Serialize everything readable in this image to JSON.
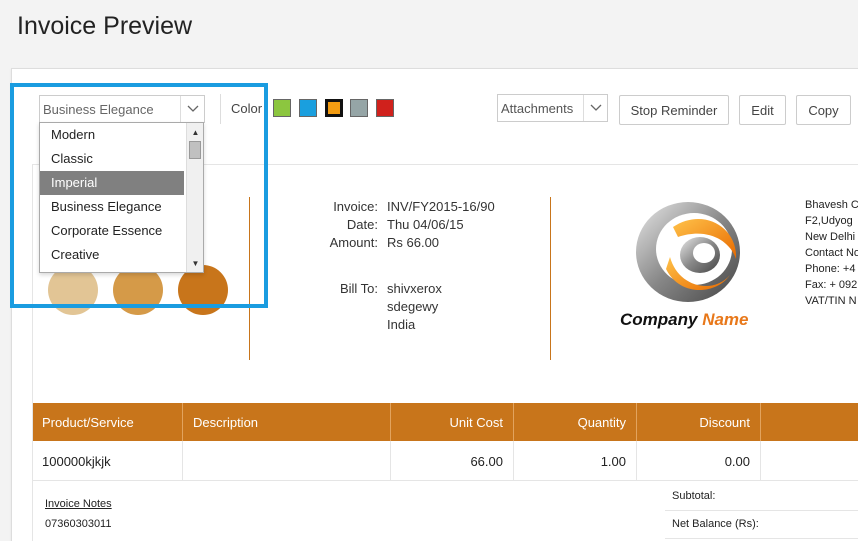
{
  "page": {
    "title": "Invoice Preview"
  },
  "toolbar": {
    "template_select": {
      "value": "Business Elegance"
    },
    "color_label": "Color",
    "colors": [
      {
        "name": "green",
        "hex": "#8cc63f",
        "selected": false
      },
      {
        "name": "blue",
        "hex": "#1a9fde",
        "selected": false
      },
      {
        "name": "orange",
        "hex": "#f39c12",
        "selected": true
      },
      {
        "name": "gray",
        "hex": "#95a5a6",
        "selected": false
      },
      {
        "name": "red",
        "hex": "#d0211c",
        "selected": false
      }
    ],
    "attachments_select": {
      "value": "Attachments"
    },
    "stop_reminder_label": "Stop Reminder",
    "edit_label": "Edit",
    "copy_label": "Copy"
  },
  "template_dropdown": {
    "items": [
      {
        "label": "Modern",
        "active": false
      },
      {
        "label": "Classic",
        "active": false
      },
      {
        "label": "Imperial",
        "active": true
      },
      {
        "label": "Business Elegance",
        "active": false
      },
      {
        "label": "Corporate Essence",
        "active": false
      },
      {
        "label": "Creative",
        "active": false
      }
    ]
  },
  "invoice": {
    "shade_circles": [
      "#e2c595",
      "#d59a48",
      "#c8751b"
    ],
    "meta": {
      "invoice_label": "Invoice:",
      "invoice_value": "INV/FY2015-16/90",
      "date_label": "Date:",
      "date_value": "Thu 04/06/15",
      "amount_label": "Amount:",
      "amount_value": "Rs 66.00",
      "bill_to_label": "Bill To:",
      "bill_to_lines": [
        "shivxerox",
        "sdegewy",
        "India"
      ]
    },
    "logo": {
      "company": "Company",
      "name": "Name"
    },
    "company_info": [
      "Bhavesh C",
      "F2,Udyog",
      "New Delhi",
      "Contact No",
      "Phone: +4",
      "Fax: + 092",
      "VAT/TIN N"
    ],
    "table": {
      "headers": [
        "Product/Service",
        "Description",
        "Unit Cost",
        "Quantity",
        "Discount"
      ],
      "rows": [
        {
          "product": "100000kjkjk",
          "description": "",
          "unit_cost": "66.00",
          "quantity": "1.00",
          "discount": "0.00"
        }
      ]
    },
    "notes": {
      "title": "Invoice Notes",
      "text": "07360303011"
    },
    "totals": {
      "subtotal_label": "Subtotal:",
      "net_balance_label": "Net Balance (Rs):"
    }
  }
}
